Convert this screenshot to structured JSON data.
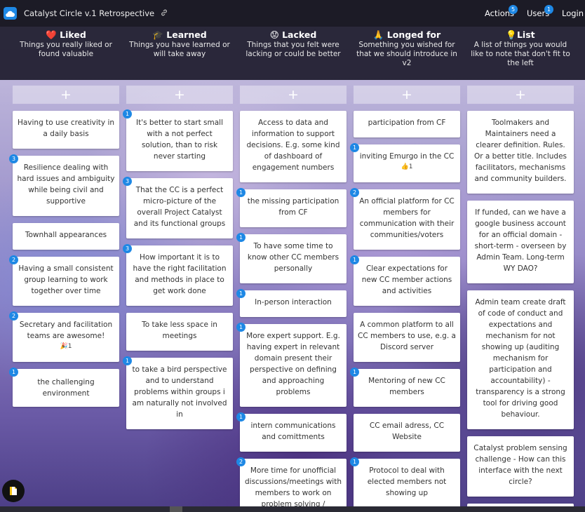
{
  "app": {
    "title": "Catalyst Circle v.1 Retrospective",
    "link_icon": "link-icon",
    "logo_icon": "cloud-icon"
  },
  "topbar": {
    "actions_label": "Actions",
    "actions_count": "5",
    "users_label": "Users",
    "users_count": "1",
    "login_label": "Login"
  },
  "colors": {
    "accent": "#1e88e5",
    "topbar": "#1c1b26",
    "header": "#1e1c2d"
  },
  "columns": [
    {
      "emoji": "❤️",
      "title": "Liked",
      "subtitle": "Things you really liked or found valuable"
    },
    {
      "emoji": "🎓",
      "title": "Learned",
      "subtitle": "Things you have learned or will take away"
    },
    {
      "emoji": "😟",
      "title": "Lacked",
      "subtitle": "Things that you felt were lacking or could be better"
    },
    {
      "emoji": "🙏",
      "title": "Longed for",
      "subtitle": "Something you wished for that we should introduce in v2"
    },
    {
      "emoji": "💡",
      "title": "List",
      "subtitle": "A list of things you would like to note that don't fit to the left"
    }
  ],
  "add_label": "+",
  "cards": {
    "liked": [
      {
        "text": "Having to use creativity in a daily basis",
        "votes": ""
      },
      {
        "text": "Resilience dealing with hard issues and ambiguity while being civil and supportive",
        "votes": "3"
      },
      {
        "text": "Townhall appearances",
        "votes": ""
      },
      {
        "text": "Having a small consistent group learning to work together over time",
        "votes": "2"
      },
      {
        "text": "Secretary and facilitation teams are awesome!",
        "votes": "2",
        "reaction": "🎉1"
      },
      {
        "text": "the challenging environment",
        "votes": "1"
      }
    ],
    "learned": [
      {
        "text": "It's better to start small with a not perfect solution, than to risk never starting",
        "votes": "1"
      },
      {
        "text": "That the CC is a perfect micro-picture of the overall Project Catalyst and its functional groups",
        "votes": "3"
      },
      {
        "text": "How important it is to have the right facilitation and methods in place to get work done",
        "votes": "3"
      },
      {
        "text": "To take less space in meetings",
        "votes": ""
      },
      {
        "text": "to take a bird perspective and to understand problems within groups i am naturally not involved in",
        "votes": "1"
      }
    ],
    "lacked": [
      {
        "text": "Access to data and information to support decisions. E.g. some kind of dashboard of engagement numbers",
        "votes": ""
      },
      {
        "text": "the missing participation from CF",
        "votes": "1"
      },
      {
        "text": "To have some time to know other CC members personally",
        "votes": "1"
      },
      {
        "text": "In-person interaction",
        "votes": "1"
      },
      {
        "text": "More expert support. E.g. having expert in relevant domain present their perspective on defining and approaching problems",
        "votes": "1"
      },
      {
        "text": "intern communications and comittments",
        "votes": "1"
      },
      {
        "text": "More time for unofficial discussions/meetings with members to work on problem solving /",
        "votes": "2"
      }
    ],
    "longed": [
      {
        "text": "participation from CF",
        "votes": ""
      },
      {
        "text": "inviting Emurgo in the CC",
        "votes": "1",
        "reaction": "👍1"
      },
      {
        "text": "An official platform for CC members for communication with their communities/voters",
        "votes": "2"
      },
      {
        "text": "Clear expectations for new CC member actions and activities",
        "votes": "1"
      },
      {
        "text": "A common platform to all CC members to use, e.g. a Discord server",
        "votes": ""
      },
      {
        "text": "Mentoring of new CC members",
        "votes": "1"
      },
      {
        "text": "CC email adress, CC Website",
        "votes": ""
      },
      {
        "text": "Protocol to deal with elected members not showing up",
        "votes": "1"
      }
    ],
    "list": [
      {
        "text": "Toolmakers and Maintainers need a clearer definition. Rules. Or a better title. Includes facilitators, mechanisms and community builders.",
        "votes": ""
      },
      {
        "text": "If funded, can we have a google business account for an official domain - short-term - overseen by Admin Team. Long-term WY DAO?",
        "votes": ""
      },
      {
        "text": "Admin team create draft of code of conduct and expectations and mechanism for not showing up (auditing mechanism for participation and accountability) - transparency is a strong tool for driving good behaviour.",
        "votes": ""
      },
      {
        "text": "Catalyst problem sensing challenge - How can this interface with the next circle?",
        "votes": ""
      }
    ]
  },
  "fab_icon": "new-document-icon"
}
